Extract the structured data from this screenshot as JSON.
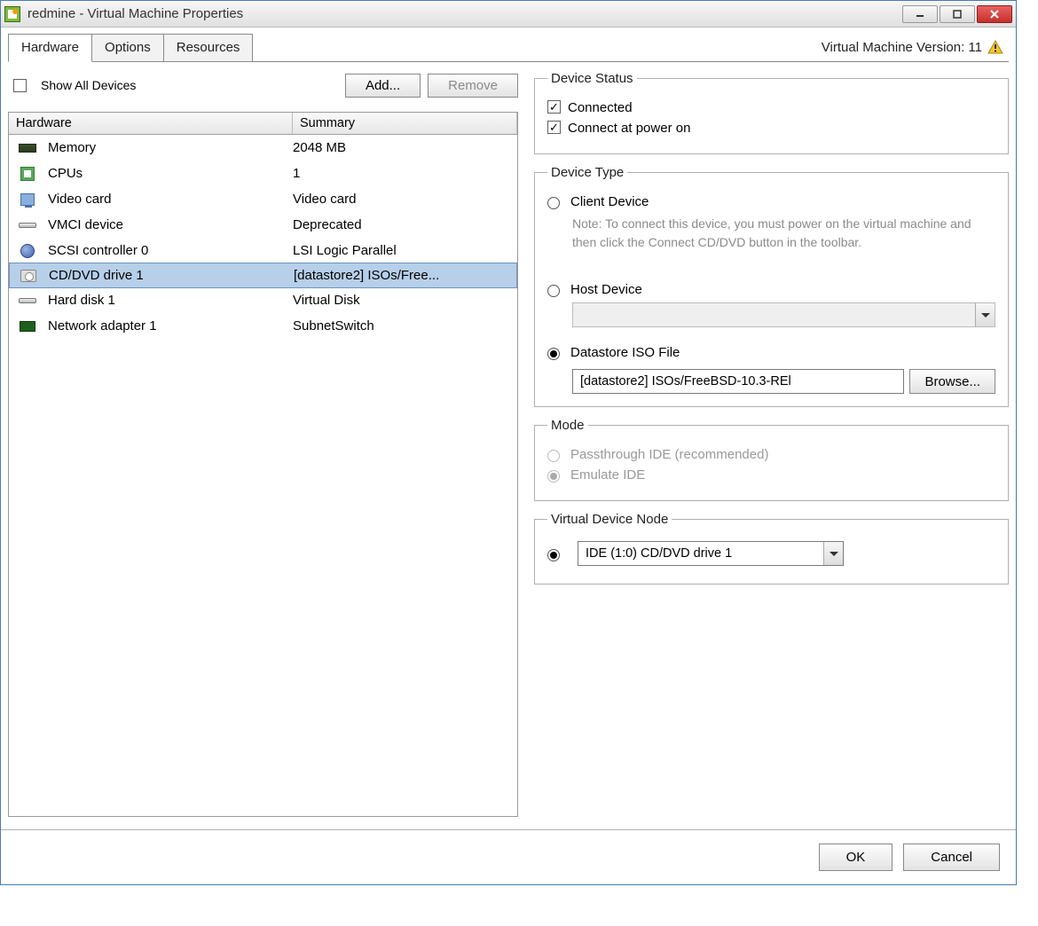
{
  "titlebar": {
    "title": "redmine - Virtual Machine Properties"
  },
  "tabs": [
    "Hardware",
    "Options",
    "Resources"
  ],
  "vm_version_label": "Virtual Machine Version: 11",
  "top": {
    "show_all_label": "Show All Devices",
    "add_label": "Add...",
    "remove_label": "Remove"
  },
  "hw_header": {
    "name": "Hardware",
    "summary": "Summary"
  },
  "hardware": [
    {
      "icon": "memory",
      "name": "Memory",
      "summary": "2048 MB"
    },
    {
      "icon": "cpu",
      "name": "CPUs",
      "summary": "1"
    },
    {
      "icon": "video",
      "name": "Video card",
      "summary": "Video card"
    },
    {
      "icon": "vmci",
      "name": "VMCI device",
      "summary": "Deprecated"
    },
    {
      "icon": "scsi",
      "name": "SCSI controller 0",
      "summary": "LSI Logic Parallel"
    },
    {
      "icon": "cd",
      "name": "CD/DVD drive 1",
      "summary": "[datastore2] ISOs/Free...",
      "selected": true
    },
    {
      "icon": "disk",
      "name": "Hard disk 1",
      "summary": "Virtual Disk"
    },
    {
      "icon": "nic",
      "name": "Network adapter 1",
      "summary": "SubnetSwitch"
    }
  ],
  "device_status": {
    "legend": "Device Status",
    "connected": "Connected",
    "connect_power": "Connect at power on"
  },
  "device_type": {
    "legend": "Device Type",
    "client": "Client Device",
    "client_note": "Note: To connect this device, you must power on the virtual machine and then click the Connect CD/DVD button in the toolbar.",
    "host": "Host Device",
    "datastore": "Datastore ISO File",
    "iso_path": "[datastore2] ISOs/FreeBSD-10.3-REl",
    "browse": "Browse..."
  },
  "mode": {
    "legend": "Mode",
    "passthrough": "Passthrough IDE (recommended)",
    "emulate": "Emulate IDE"
  },
  "vdn": {
    "legend": "Virtual Device Node",
    "value": "IDE (1:0) CD/DVD drive 1"
  },
  "footer": {
    "ok": "OK",
    "cancel": "Cancel"
  }
}
